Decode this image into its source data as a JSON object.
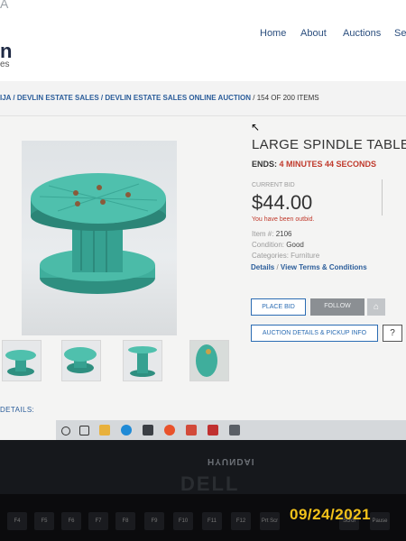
{
  "site": {
    "brand_letter": "n",
    "brand_sub": "es",
    "brand_top": "A"
  },
  "nav": {
    "items": [
      "Home",
      "About",
      "Auctions",
      "Se"
    ]
  },
  "breadcrumb": {
    "part1": "IJA",
    "part2": "DEVLIN ESTATE SALES",
    "part3": "DEVLIN ESTATE SALES ONLINE AUCTION",
    "count": "154 OF 200 ITEMS"
  },
  "item": {
    "title": "LARGE SPINDLE TABLE O",
    "ends_label": "ENDS:",
    "ends_time": "4 MINUTES 44 SECONDS",
    "current_bid_label": "CURRENT BID",
    "current_bid": "$44.00",
    "outbid_msg": "You have been outbid.",
    "item_no_label": "Item #:",
    "item_no": "2106",
    "condition_label": "Condition:",
    "condition": "Good",
    "categories_label": "Categories:",
    "categories": "Furniture",
    "details_link": "Details",
    "terms_link": "View Terms & Conditions"
  },
  "buttons": {
    "place_bid": "PLACE BID",
    "follow": "FOLLOW",
    "home_icon": "⌂",
    "auction_details": "AUCTION DETAILS & PICKUP INFO",
    "help": "?"
  },
  "tabs": {
    "details": "DETAILS:"
  },
  "monitor": {
    "brand": "HYUNDAI",
    "base_logo": "DELL"
  },
  "keyboard": {
    "keys": [
      "F4",
      "F5",
      "F6",
      "F7",
      "F8",
      "F9",
      "F10",
      "F11",
      "F12",
      "Prt Scr",
      "Scrol",
      "Pause"
    ]
  },
  "photo": {
    "date_stamp": "09/24/2021"
  },
  "colors": {
    "spool": "#3fae9c",
    "link": "#2b5d9a",
    "alert": "#c0392b",
    "date": "#f3c21a"
  }
}
